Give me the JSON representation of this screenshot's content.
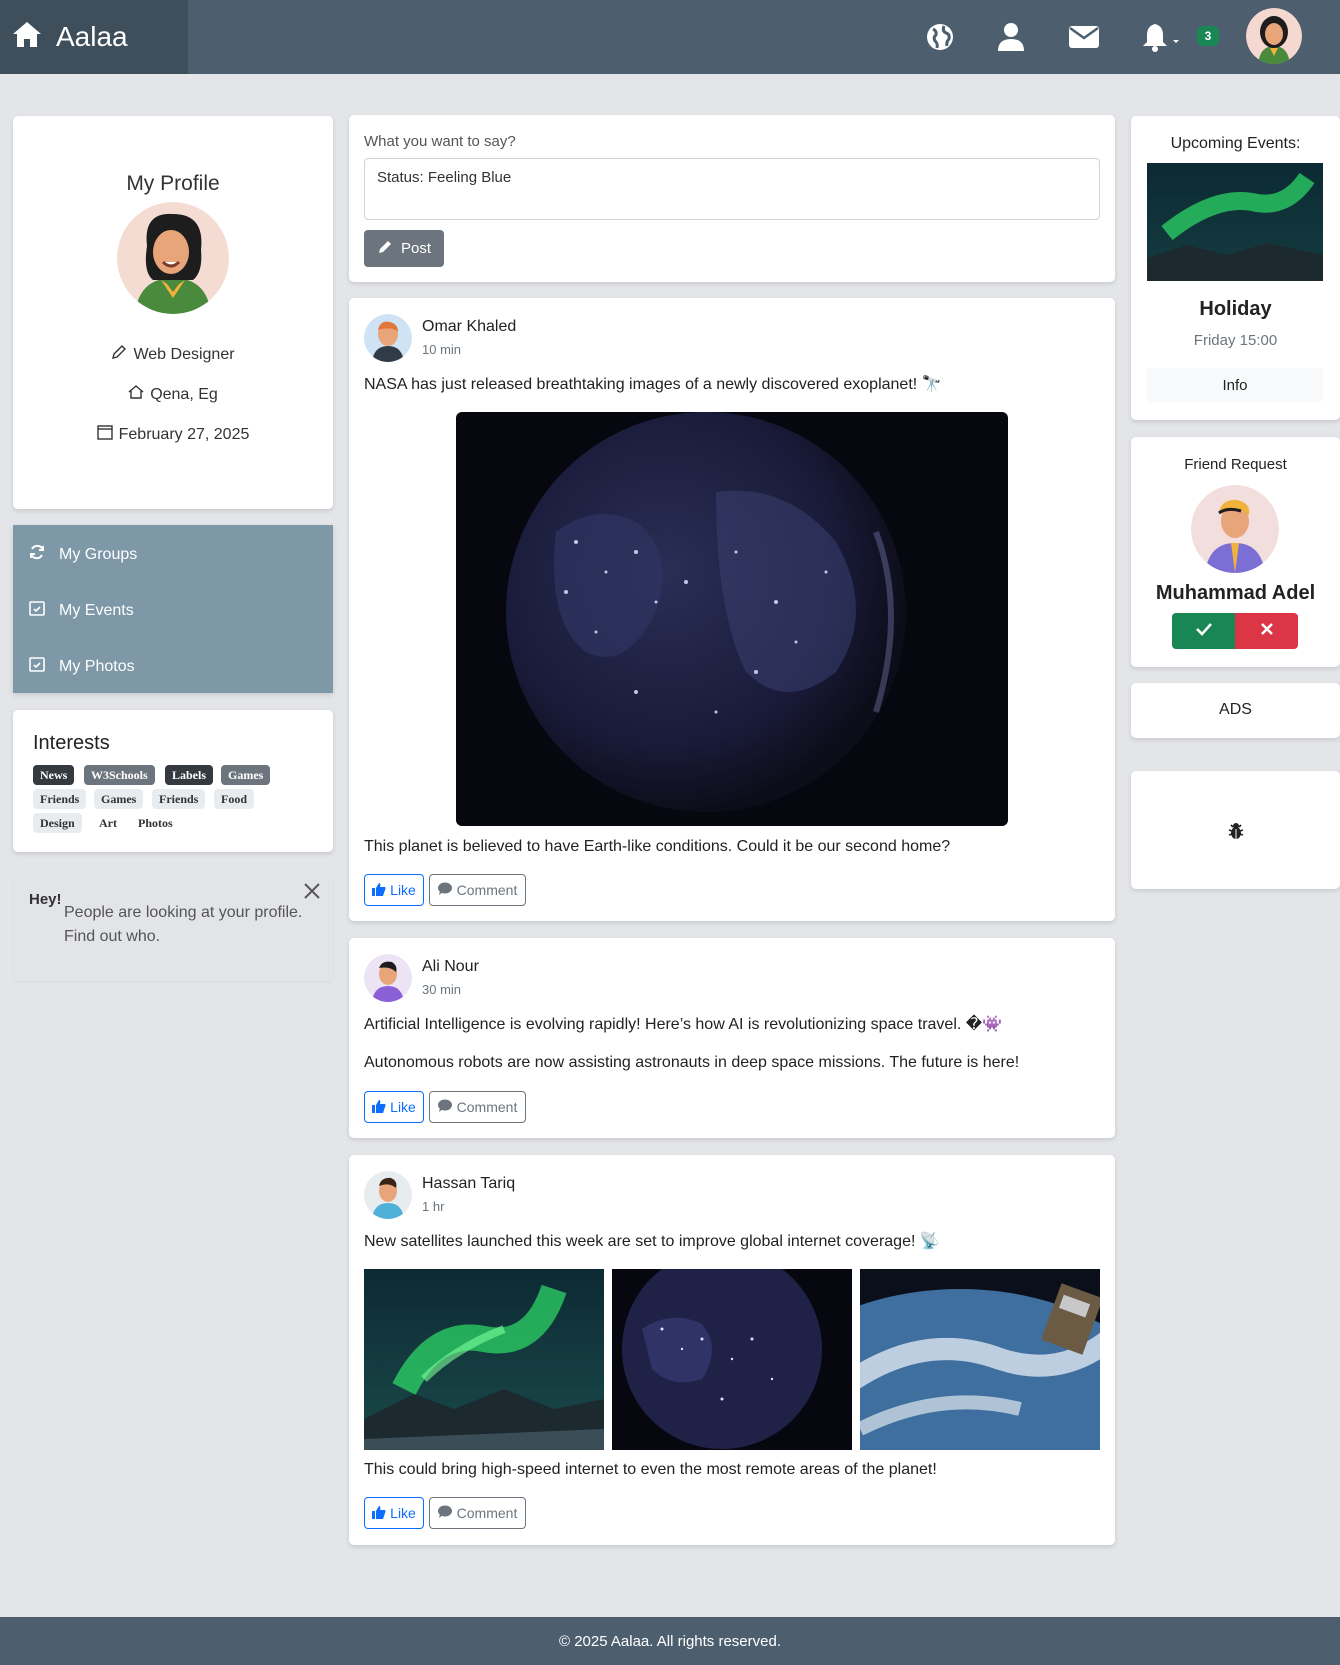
{
  "brand": {
    "name": "Aalaa",
    "icon": "home-icon"
  },
  "nav": {
    "icons": [
      "globe-icon",
      "user-icon",
      "envelope-icon",
      "bell-icon"
    ],
    "notification_count": "3"
  },
  "profile": {
    "title": "My Profile",
    "job": "Web Designer",
    "location": "Qena, Eg",
    "date": "February 27, 2025"
  },
  "menu": {
    "items": [
      {
        "label": "My Groups",
        "icon": "refresh-icon"
      },
      {
        "label": "My Events",
        "icon": "calendar-check-icon"
      },
      {
        "label": "My Photos",
        "icon": "calendar-check-icon"
      }
    ]
  },
  "interests": {
    "title": "Interests",
    "tags": [
      "News",
      "W3Schools",
      "Labels",
      "Games",
      "Friends",
      "Games",
      "Friends",
      "Food",
      "Design",
      "Art",
      "Photos"
    ]
  },
  "alert": {
    "title": "Hey!",
    "line1": "People are looking at your profile.",
    "line2": "Find out who."
  },
  "composer": {
    "label": "What you want to say?",
    "value": "Status: Feeling Blue",
    "button": "Post"
  },
  "posts": [
    {
      "author": "Omar Khaled",
      "time": "10 min",
      "text": "NASA has just released breathtaking images of a newly discovered exoplanet! 🔭",
      "caption": "This planet is believed to have Earth-like conditions. Could it be our second home?",
      "like": "Like",
      "comment": "Comment"
    },
    {
      "author": "Ali Nour",
      "time": "30 min",
      "text": "Artificial Intelligence is evolving rapidly! Here’s how AI is revolutionizing space travel. �👾",
      "caption": "Autonomous robots are now assisting astronauts in deep space missions. The future is here!",
      "like": "Like",
      "comment": "Comment"
    },
    {
      "author": "Hassan Tariq",
      "time": "1 hr",
      "text": "New satellites launched this week are set to improve global internet coverage! 📡",
      "caption": "This could bring high-speed internet to even the most remote areas of the planet!",
      "like": "Like",
      "comment": "Comment"
    }
  ],
  "events": {
    "title": "Upcoming Events:",
    "name": "Holiday",
    "time": "Friday 15:00",
    "button": "Info"
  },
  "friend_request": {
    "title": "Friend Request",
    "name": "Muhammad Adel"
  },
  "ads": {
    "label": "ADS"
  },
  "bug": {
    "icon": "bug-icon"
  },
  "footer": {
    "text": "© 2025 Aalaa. All rights reserved."
  },
  "colors": {
    "navbar": "#4d5f6f",
    "menu": "#7e98a8",
    "accept": "#198754",
    "decline": "#dc3545",
    "link": "#0d6efd"
  }
}
